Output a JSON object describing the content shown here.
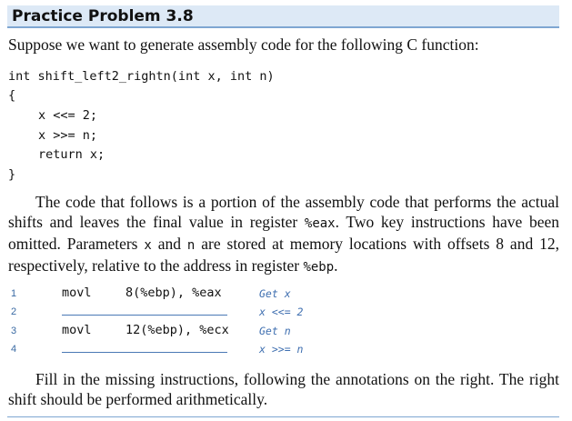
{
  "header": {
    "title": "Practice Problem 3.8"
  },
  "intro": "Suppose we want to generate assembly code for the following C function:",
  "c_code": [
    "int shift_left2_rightn(int x, int n)",
    "{",
    "x <<= 2;",
    "x >>= n;",
    "return x;",
    "}"
  ],
  "paragraph": {
    "s1": "The code that follows is a portion of the assembly code that performs the actual shifts and leaves the final value in register ",
    "r1": "%eax",
    "s2": ". Two key instructions have been omitted. Parameters ",
    "p1": "x",
    "s3": " and ",
    "p2": "n",
    "s4": " are stored at memory locations with offsets 8 and 12, respectively, relative to the address in register ",
    "r2": "%ebp",
    "s5": "."
  },
  "assembly": [
    {
      "num": "1",
      "op": "movl",
      "args": "8(%ebp), %eax",
      "comment": "Get x"
    },
    {
      "num": "2",
      "op": "",
      "args": "",
      "comment": "x <<= 2"
    },
    {
      "num": "3",
      "op": "movl",
      "args": "12(%ebp), %ecx",
      "comment": "Get n"
    },
    {
      "num": "4",
      "op": "",
      "args": "",
      "comment": "x >>= n"
    }
  ],
  "closing": "Fill in the missing instructions, following the annotations on the right. The right shift should be performed arithmetically."
}
